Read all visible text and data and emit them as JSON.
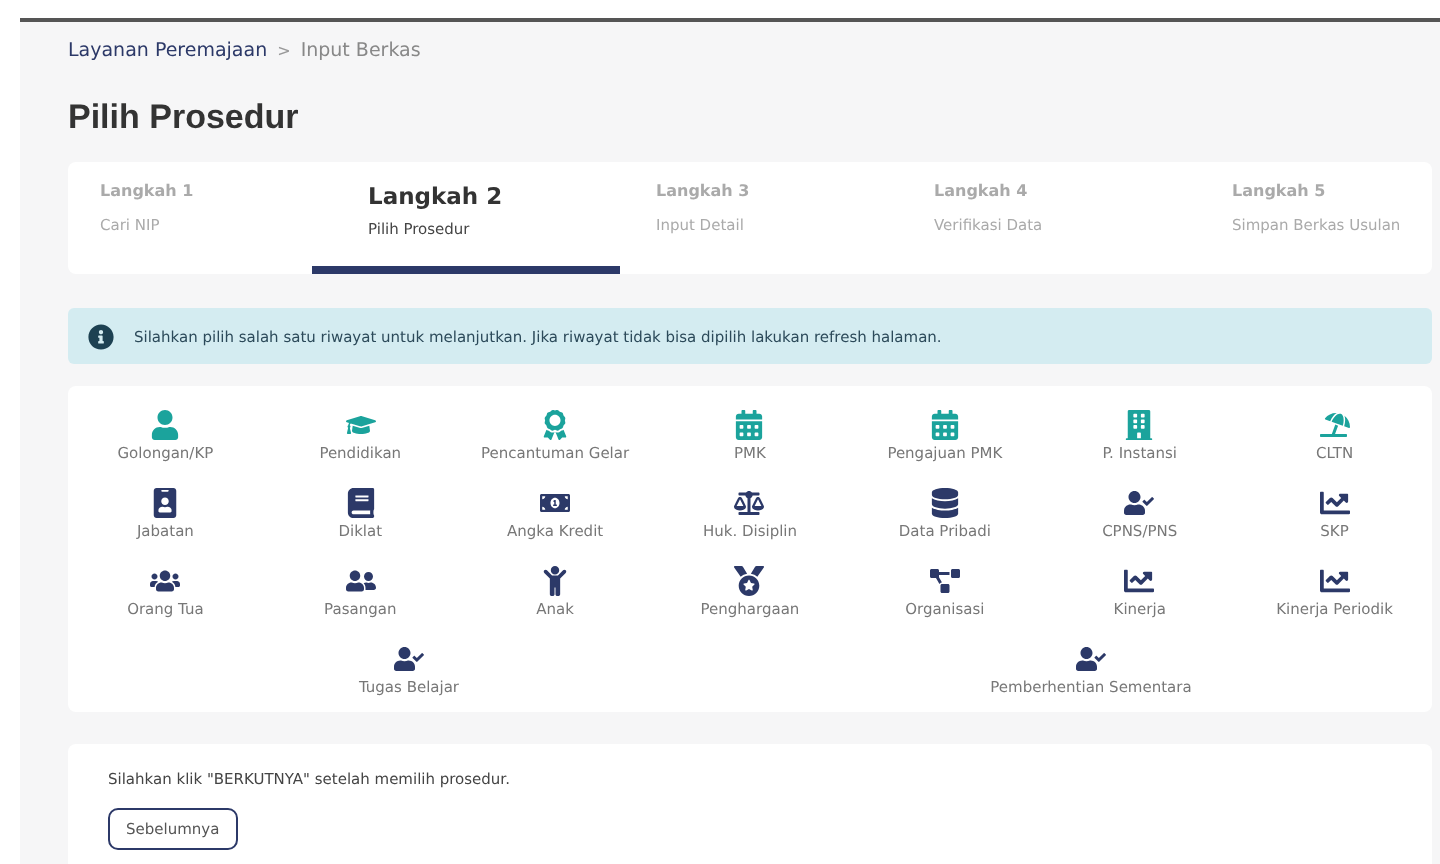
{
  "breadcrumb": [
    {
      "label": "Layanan Peremajaan",
      "current": false
    },
    {
      "label": "Input Berkas",
      "current": true
    }
  ],
  "breadcrumb_separator": ">",
  "title": "Pilih Prosedur",
  "steps": [
    {
      "label": "Langkah 1",
      "caption": "Cari NIP",
      "selected": false
    },
    {
      "label": "Langkah 2",
      "caption": "Pilih Prosedur",
      "selected": true
    },
    {
      "label": "Langkah 3",
      "caption": "Input Detail",
      "selected": false
    },
    {
      "label": "Langkah 4",
      "caption": "Verifikasi Data",
      "selected": false
    },
    {
      "label": "Langkah 5",
      "caption": "Simpan Berkas Usulan",
      "selected": false
    }
  ],
  "alert": {
    "text": "Silahkan pilih salah satu riwayat untuk melanjutkan. Jika riwayat tidak bisa dipilih lakukan refresh halaman."
  },
  "procedure_rows": [
    {
      "items": [
        {
          "label": "Golongan/KP",
          "kind": "person",
          "color": "#1ba39c"
        },
        {
          "label": "Pendidikan",
          "kind": "cap",
          "color": "#1ba39c"
        },
        {
          "label": "Pencantuman Gelar",
          "kind": "award",
          "color": "#1ba39c"
        },
        {
          "label": "PMK",
          "kind": "calendar",
          "color": "#1ba39c"
        },
        {
          "label": "Pengajuan PMK",
          "kind": "calendar",
          "color": "#1ba39c"
        },
        {
          "label": "P. Instansi",
          "kind": "building",
          "color": "#1ba39c"
        },
        {
          "label": "CLTN",
          "kind": "umbrella",
          "color": "#1ba39c"
        }
      ]
    },
    {
      "items": [
        {
          "label": "Jabatan",
          "kind": "badge",
          "color": "#2c3968"
        },
        {
          "label": "Diklat",
          "kind": "book",
          "color": "#2c3968"
        },
        {
          "label": "Angka Kredit",
          "kind": "money",
          "color": "#2c3968"
        },
        {
          "label": "Huk. Disiplin",
          "kind": "scale",
          "color": "#2c3968"
        },
        {
          "label": "Data Pribadi",
          "kind": "database",
          "color": "#2c3968"
        },
        {
          "label": "CPNS/PNS",
          "kind": "usercheck",
          "color": "#2c3968"
        },
        {
          "label": "SKP",
          "kind": "chart",
          "color": "#2c3968"
        }
      ]
    },
    {
      "items": [
        {
          "label": "Orang Tua",
          "kind": "family",
          "color": "#2c3968"
        },
        {
          "label": "Pasangan",
          "kind": "couple",
          "color": "#2c3968"
        },
        {
          "label": "Anak",
          "kind": "child",
          "color": "#2c3968"
        },
        {
          "label": "Penghargaan",
          "kind": "medal",
          "color": "#2c3968"
        },
        {
          "label": "Organisasi",
          "kind": "network",
          "color": "#2c3968"
        },
        {
          "label": "Kinerja",
          "kind": "chart",
          "color": "#2c3968"
        },
        {
          "label": "Kinerja Periodik",
          "kind": "chart",
          "color": "#2c3968"
        }
      ]
    },
    {
      "items": [
        {
          "label": "Tugas Belajar",
          "kind": "usercheck",
          "color": "#2c3968"
        },
        {
          "label": "Pemberhentian Sementara",
          "kind": "usercheck",
          "color": "#2c3968"
        }
      ]
    }
  ],
  "footer": {
    "note": "Silahkan klik \"BERKUTNYA\" setelah memilih prosedur.",
    "back_button": "Sebelumnya"
  }
}
